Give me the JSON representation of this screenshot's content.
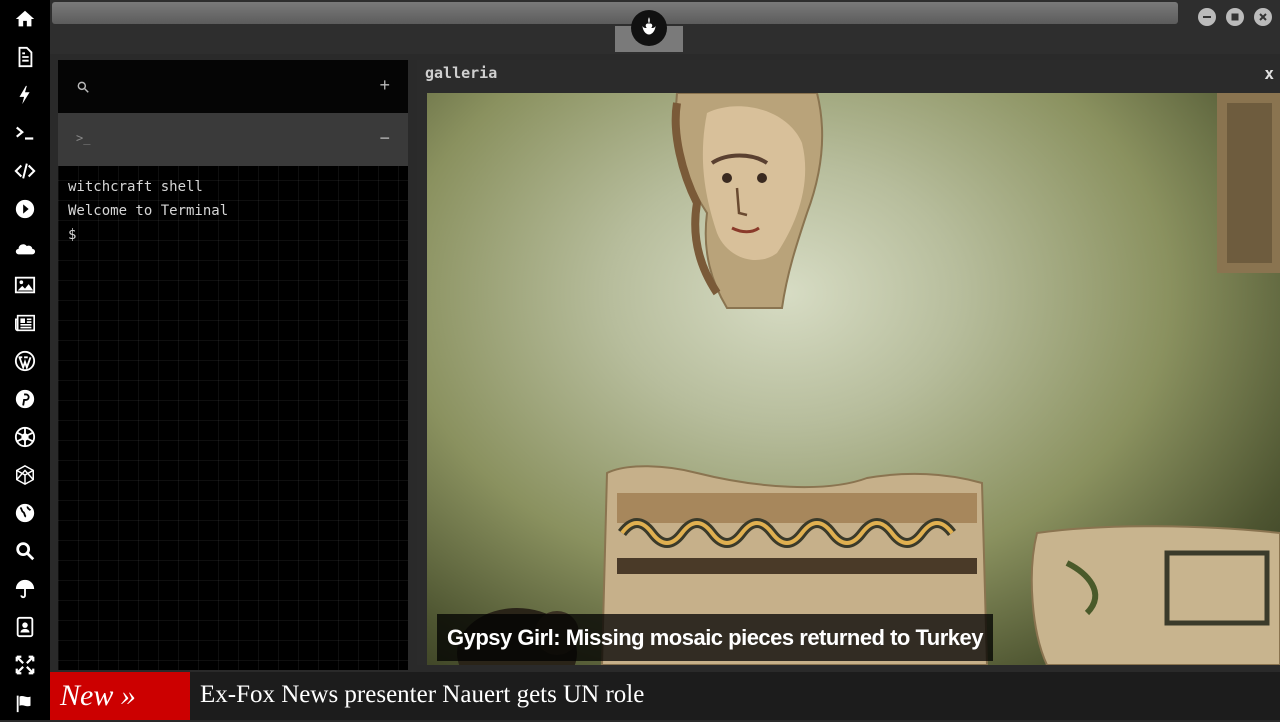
{
  "sidebar": {
    "icons": [
      "home-icon",
      "document-icon",
      "bolt-icon",
      "terminal-icon",
      "code-icon",
      "play-icon",
      "cloud-icon",
      "image-icon",
      "newspaper-icon",
      "wordpress-icon",
      "pinterest-icon",
      "rebel-icon",
      "globe-wireframe-icon",
      "earth-icon",
      "search-icon",
      "umbrella-icon",
      "contacts-icon",
      "expand-icon",
      "flag-icon"
    ]
  },
  "terminal": {
    "lines": [
      "witchcraft shell",
      "Welcome to Terminal",
      "$"
    ],
    "search_icon": "search-icon",
    "add_label": "+",
    "prompt_icon": ">_",
    "minimize_label": "−"
  },
  "galleria": {
    "title": "galleria",
    "close_label": "x",
    "caption": "Gypsy Girl: Missing mosaic pieces returned to Turkey"
  },
  "ticker": {
    "badge": "New »",
    "headline": "Ex-Fox News presenter Nauert gets UN role"
  },
  "colors": {
    "sidebar_bg": "#000000",
    "ticker_badge": "#cc0000",
    "panel_bg": "#2b2b2b"
  }
}
